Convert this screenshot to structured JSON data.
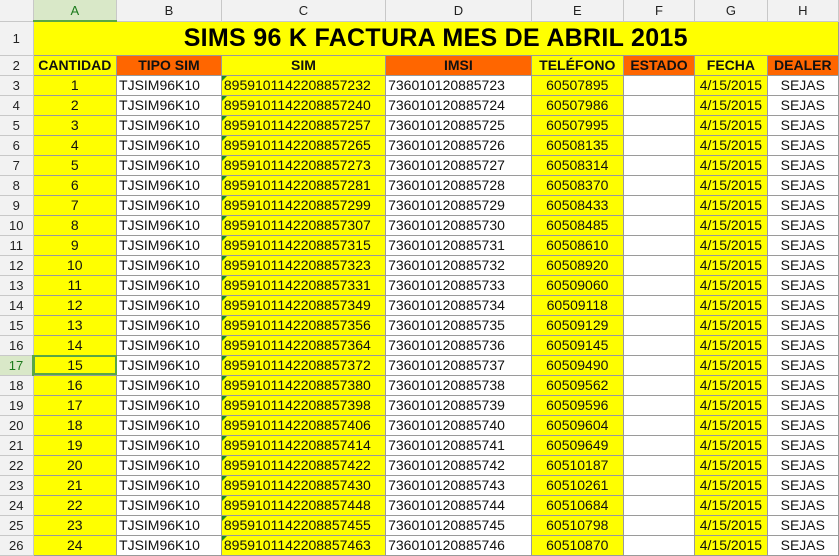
{
  "columns": [
    "A",
    "B",
    "C",
    "D",
    "E",
    "F",
    "G",
    "H"
  ],
  "selected_column": "A",
  "selected_row": "17",
  "title": "SIMS 96 K FACTURA MES DE ABRIL 2015",
  "headers": {
    "cantidad": "CANTIDAD",
    "tipo_sim": "TIPO SIM",
    "sim": "SIM",
    "imsi": "IMSI",
    "telefono": "TELÉFONO",
    "estado": "ESTADO",
    "fecha": "FECHA",
    "dealer": "DEALER"
  },
  "row_numbers": [
    "1",
    "2",
    "3",
    "4",
    "5",
    "6",
    "7",
    "8",
    "9",
    "10",
    "11",
    "12",
    "13",
    "14",
    "15",
    "16",
    "17",
    "18",
    "19",
    "20",
    "21",
    "22",
    "23",
    "24",
    "25",
    "26"
  ],
  "rows": [
    {
      "cantidad": "1",
      "tipo_sim": "TJSIM96K10",
      "sim": "8959101142208857232",
      "imsi": "736010120885723",
      "telefono": "60507895",
      "estado": "",
      "fecha": "4/15/2015",
      "dealer": "SEJAS"
    },
    {
      "cantidad": "2",
      "tipo_sim": "TJSIM96K10",
      "sim": "8959101142208857240",
      "imsi": "736010120885724",
      "telefono": "60507986",
      "estado": "",
      "fecha": "4/15/2015",
      "dealer": "SEJAS"
    },
    {
      "cantidad": "3",
      "tipo_sim": "TJSIM96K10",
      "sim": "8959101142208857257",
      "imsi": "736010120885725",
      "telefono": "60507995",
      "estado": "",
      "fecha": "4/15/2015",
      "dealer": "SEJAS"
    },
    {
      "cantidad": "4",
      "tipo_sim": "TJSIM96K10",
      "sim": "8959101142208857265",
      "imsi": "736010120885726",
      "telefono": "60508135",
      "estado": "",
      "fecha": "4/15/2015",
      "dealer": "SEJAS"
    },
    {
      "cantidad": "5",
      "tipo_sim": "TJSIM96K10",
      "sim": "8959101142208857273",
      "imsi": "736010120885727",
      "telefono": "60508314",
      "estado": "",
      "fecha": "4/15/2015",
      "dealer": "SEJAS"
    },
    {
      "cantidad": "6",
      "tipo_sim": "TJSIM96K10",
      "sim": "8959101142208857281",
      "imsi": "736010120885728",
      "telefono": "60508370",
      "estado": "",
      "fecha": "4/15/2015",
      "dealer": "SEJAS"
    },
    {
      "cantidad": "7",
      "tipo_sim": "TJSIM96K10",
      "sim": "8959101142208857299",
      "imsi": "736010120885729",
      "telefono": "60508433",
      "estado": "",
      "fecha": "4/15/2015",
      "dealer": "SEJAS"
    },
    {
      "cantidad": "8",
      "tipo_sim": "TJSIM96K10",
      "sim": "8959101142208857307",
      "imsi": "736010120885730",
      "telefono": "60508485",
      "estado": "",
      "fecha": "4/15/2015",
      "dealer": "SEJAS"
    },
    {
      "cantidad": "9",
      "tipo_sim": "TJSIM96K10",
      "sim": "8959101142208857315",
      "imsi": "736010120885731",
      "telefono": "60508610",
      "estado": "",
      "fecha": "4/15/2015",
      "dealer": "SEJAS"
    },
    {
      "cantidad": "10",
      "tipo_sim": "TJSIM96K10",
      "sim": "8959101142208857323",
      "imsi": "736010120885732",
      "telefono": "60508920",
      "estado": "",
      "fecha": "4/15/2015",
      "dealer": "SEJAS"
    },
    {
      "cantidad": "11",
      "tipo_sim": "TJSIM96K10",
      "sim": "8959101142208857331",
      "imsi": "736010120885733",
      "telefono": "60509060",
      "estado": "",
      "fecha": "4/15/2015",
      "dealer": "SEJAS"
    },
    {
      "cantidad": "12",
      "tipo_sim": "TJSIM96K10",
      "sim": "8959101142208857349",
      "imsi": "736010120885734",
      "telefono": "60509118",
      "estado": "",
      "fecha": "4/15/2015",
      "dealer": "SEJAS"
    },
    {
      "cantidad": "13",
      "tipo_sim": "TJSIM96K10",
      "sim": "8959101142208857356",
      "imsi": "736010120885735",
      "telefono": "60509129",
      "estado": "",
      "fecha": "4/15/2015",
      "dealer": "SEJAS"
    },
    {
      "cantidad": "14",
      "tipo_sim": "TJSIM96K10",
      "sim": "8959101142208857364",
      "imsi": "736010120885736",
      "telefono": "60509145",
      "estado": "",
      "fecha": "4/15/2015",
      "dealer": "SEJAS"
    },
    {
      "cantidad": "15",
      "tipo_sim": "TJSIM96K10",
      "sim": "8959101142208857372",
      "imsi": "736010120885737",
      "telefono": "60509490",
      "estado": "",
      "fecha": "4/15/2015",
      "dealer": "SEJAS"
    },
    {
      "cantidad": "16",
      "tipo_sim": "TJSIM96K10",
      "sim": "8959101142208857380",
      "imsi": "736010120885738",
      "telefono": "60509562",
      "estado": "",
      "fecha": "4/15/2015",
      "dealer": "SEJAS"
    },
    {
      "cantidad": "17",
      "tipo_sim": "TJSIM96K10",
      "sim": "8959101142208857398",
      "imsi": "736010120885739",
      "telefono": "60509596",
      "estado": "",
      "fecha": "4/15/2015",
      "dealer": "SEJAS"
    },
    {
      "cantidad": "18",
      "tipo_sim": "TJSIM96K10",
      "sim": "8959101142208857406",
      "imsi": "736010120885740",
      "telefono": "60509604",
      "estado": "",
      "fecha": "4/15/2015",
      "dealer": "SEJAS"
    },
    {
      "cantidad": "19",
      "tipo_sim": "TJSIM96K10",
      "sim": "8959101142208857414",
      "imsi": "736010120885741",
      "telefono": "60509649",
      "estado": "",
      "fecha": "4/15/2015",
      "dealer": "SEJAS"
    },
    {
      "cantidad": "20",
      "tipo_sim": "TJSIM96K10",
      "sim": "8959101142208857422",
      "imsi": "736010120885742",
      "telefono": "60510187",
      "estado": "",
      "fecha": "4/15/2015",
      "dealer": "SEJAS"
    },
    {
      "cantidad": "21",
      "tipo_sim": "TJSIM96K10",
      "sim": "8959101142208857430",
      "imsi": "736010120885743",
      "telefono": "60510261",
      "estado": "",
      "fecha": "4/15/2015",
      "dealer": "SEJAS"
    },
    {
      "cantidad": "22",
      "tipo_sim": "TJSIM96K10",
      "sim": "8959101142208857448",
      "imsi": "736010120885744",
      "telefono": "60510684",
      "estado": "",
      "fecha": "4/15/2015",
      "dealer": "SEJAS"
    },
    {
      "cantidad": "23",
      "tipo_sim": "TJSIM96K10",
      "sim": "8959101142208857455",
      "imsi": "736010120885745",
      "telefono": "60510798",
      "estado": "",
      "fecha": "4/15/2015",
      "dealer": "SEJAS"
    },
    {
      "cantidad": "24",
      "tipo_sim": "TJSIM96K10",
      "sim": "8959101142208857463",
      "imsi": "736010120885746",
      "telefono": "60510870",
      "estado": "",
      "fecha": "4/15/2015",
      "dealer": "SEJAS"
    }
  ],
  "colors": {
    "yellow": "#ffff00",
    "orange": "#ff6600",
    "selection_green": "#5aa646",
    "header_gray": "#f2f2f2"
  }
}
